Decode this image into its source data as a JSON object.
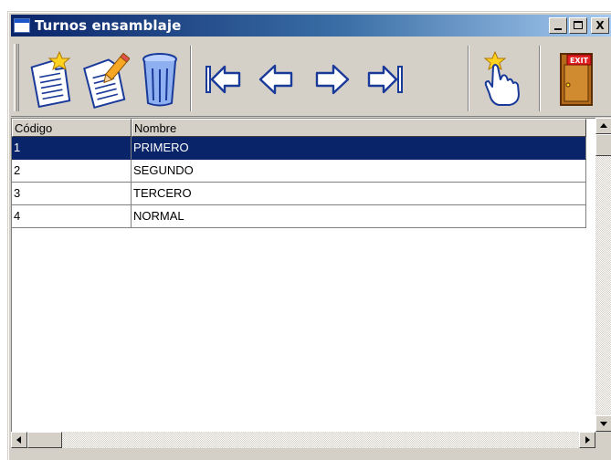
{
  "window": {
    "title": "Turnos ensamblaje",
    "buttons": [
      "minimize",
      "maximize",
      "close"
    ],
    "close_glyph": "X"
  },
  "toolbar": {
    "tools": [
      {
        "name": "new-record",
        "icon": "new-document-icon"
      },
      {
        "name": "edit-record",
        "icon": "edit-document-icon"
      },
      {
        "name": "delete-record",
        "icon": "trash-icon"
      },
      {
        "name": "first-record",
        "icon": "first-arrow-icon"
      },
      {
        "name": "previous-record",
        "icon": "left-arrow-icon"
      },
      {
        "name": "next-record",
        "icon": "right-arrow-icon"
      },
      {
        "name": "last-record",
        "icon": "last-arrow-icon"
      },
      {
        "name": "select-record",
        "icon": "pointing-hand-icon"
      },
      {
        "name": "exit",
        "icon": "exit-door-icon",
        "label": "EXIT"
      }
    ]
  },
  "grid": {
    "columns": [
      "Código",
      "Nombre"
    ],
    "rows": [
      {
        "codigo": "1",
        "nombre": "PRIMERO",
        "selected": true
      },
      {
        "codigo": "2",
        "nombre": "SEGUNDO",
        "selected": false
      },
      {
        "codigo": "3",
        "nombre": "TERCERO",
        "selected": false
      },
      {
        "codigo": "4",
        "nombre": "NORMAL",
        "selected": false
      }
    ]
  },
  "colors": {
    "selection": "#0a246a",
    "titlebar_start": "#0a246a",
    "titlebar_end": "#a6caf0",
    "face": "#d4d0c8"
  }
}
